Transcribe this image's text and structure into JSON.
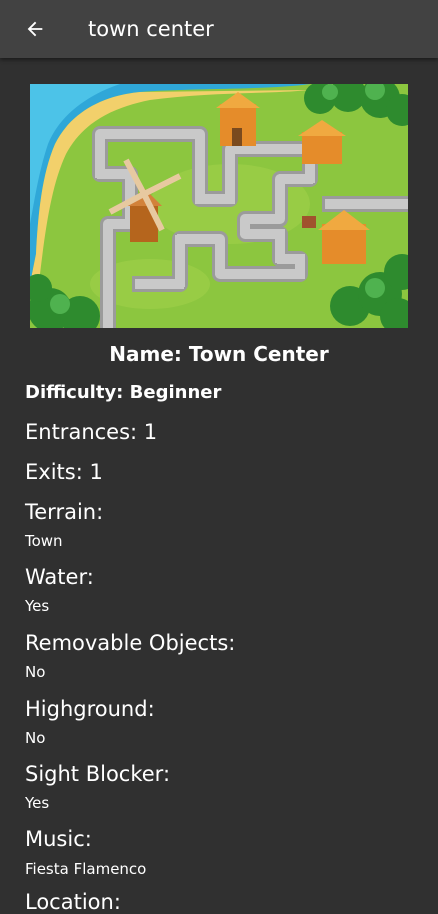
{
  "appbar": {
    "title": "town center",
    "back_icon": "arrow-left-icon"
  },
  "map": {
    "name_line": "Name: Town Center",
    "difficulty_line": "Difficulty: Beginner",
    "entrances_line": "Entrances: 1",
    "exits_line": "Exits: 1",
    "properties": [
      {
        "label": "Terrain:",
        "value": "Town"
      },
      {
        "label": "Water:",
        "value": "Yes"
      },
      {
        "label": "Removable Objects:",
        "value": "No"
      },
      {
        "label": "Highground:",
        "value": "No"
      },
      {
        "label": "Sight Blocker:",
        "value": "Yes"
      },
      {
        "label": "Music:",
        "value": "Fiesta Flamenco"
      }
    ],
    "cutoff_label": "Location:"
  },
  "colors": {
    "background": "#303030",
    "appbar": "#424242",
    "grass": "#8cc63f",
    "water": "#3fb8e0",
    "path": "#a9a9a9"
  }
}
